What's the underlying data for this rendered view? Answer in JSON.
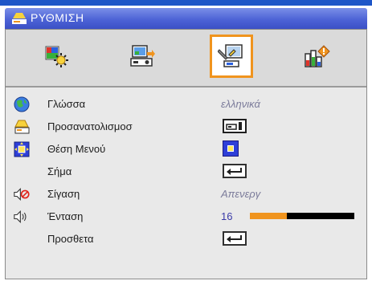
{
  "menu": {
    "title": "ΡΥΘΜΙΣΗ",
    "tabs": [
      {
        "name": "image-settings",
        "icon": "image-settings-icon",
        "selected": false
      },
      {
        "name": "display",
        "icon": "display-icon",
        "selected": false
      },
      {
        "name": "setup",
        "icon": "setup-icon",
        "selected": true
      },
      {
        "name": "options",
        "icon": "options-icon",
        "selected": false
      }
    ],
    "rows": {
      "language": {
        "label": "Γλώσσα",
        "value": "ελληνικά",
        "icon": "globe-icon"
      },
      "projection": {
        "label": "Προσανατολισμοσ",
        "icon": "projection-icon"
      },
      "menu_location": {
        "label": "Θέση Μενού",
        "icon": "menu-location-icon"
      },
      "signal": {
        "label": "Σήμα"
      },
      "mute": {
        "label": "Σίγαση",
        "value": "Απενεργ",
        "icon": "mute-icon"
      },
      "volume": {
        "label": "Ένταση",
        "value": "16",
        "level_fraction": 0.35,
        "icon": "speaker-icon"
      },
      "advanced": {
        "label": "Προσθετα"
      }
    }
  },
  "colors": {
    "title_bar": "#4d63d6",
    "selection_border": "#f0941e",
    "volume_fill": "#f0941e",
    "volume_track": "#000000"
  }
}
